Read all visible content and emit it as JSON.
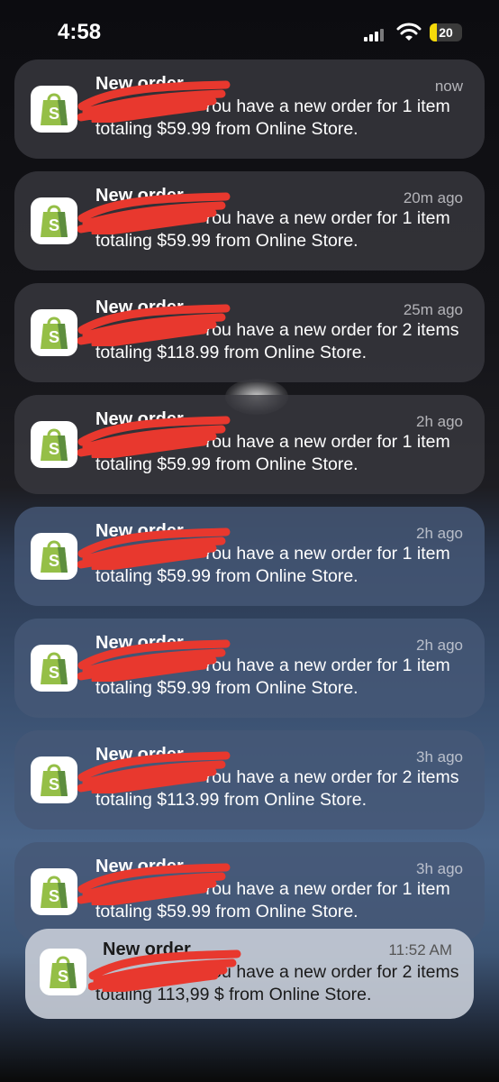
{
  "status_bar": {
    "time": "4:58",
    "battery_percent": "20"
  },
  "notifications": [
    {
      "app_title": "New order",
      "timestamp": "now",
      "message": "You have a new order for 1 item totaling $59.99 from Online Store."
    },
    {
      "app_title": "New order",
      "timestamp": "20m ago",
      "message": "You have a new order for 1 item totaling $59.99 from Online Store."
    },
    {
      "app_title": "New order",
      "timestamp": "25m ago",
      "message": "You have a new order for 2 items totaling $118.99 from Online Store."
    },
    {
      "app_title": "New order",
      "timestamp": "2h ago",
      "message": "You have a new order for 1 item totaling $59.99 from Online Store."
    },
    {
      "app_title": "New order",
      "timestamp": "2h ago",
      "message": "You have a new order for 1 item totaling $59.99 from Online Store."
    },
    {
      "app_title": "New order",
      "timestamp": "2h ago",
      "message": "You have a new order for 1 item totaling $59.99 from Online Store."
    },
    {
      "app_title": "New order",
      "timestamp": "3h ago",
      "message": "You have a new order for 2 items totaling $113.99 from Online Store."
    },
    {
      "app_title": "New order",
      "timestamp": "3h ago",
      "message": "You have a new order for 1 item totaling $59.99 from Online Store."
    },
    {
      "app_title": "New order",
      "timestamp": "11:52 AM",
      "message": "You have a new order for 2 items totaling 113,99 $ from Online Store."
    }
  ],
  "colors": {
    "brand_green": "#95bf47",
    "redaction": "#e8382e",
    "battery_fill": "#f5d90a"
  },
  "icons": {
    "app": "shopify-bag-icon"
  }
}
